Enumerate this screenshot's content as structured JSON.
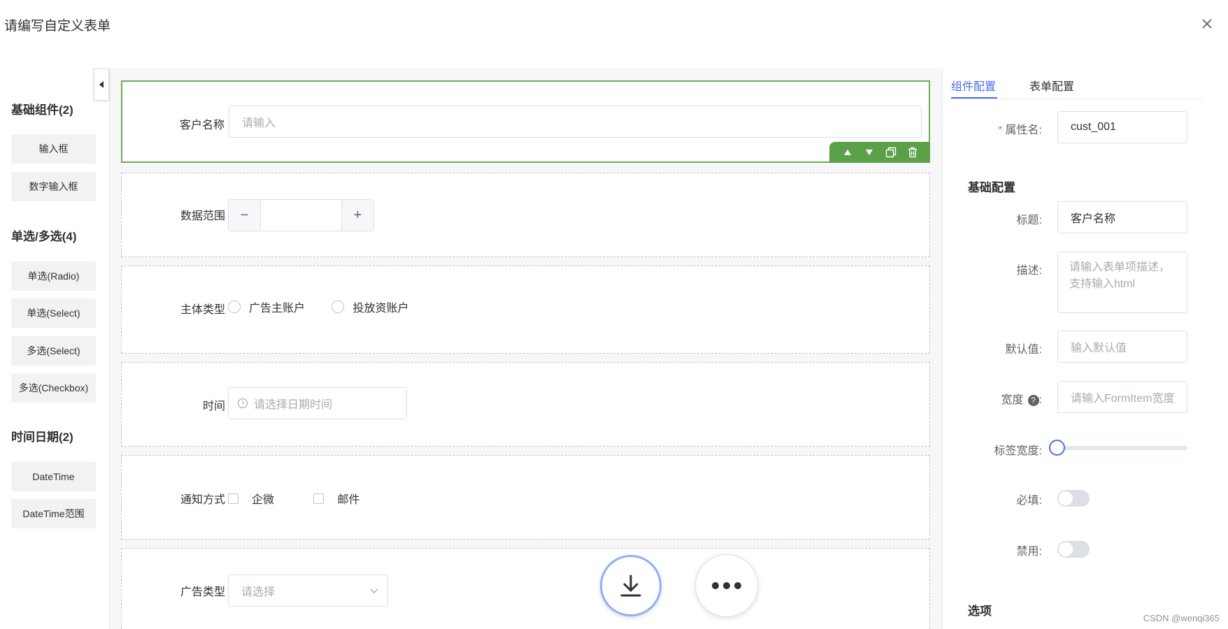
{
  "dialog": {
    "title": "请编写自定义表单"
  },
  "palette": {
    "groups": [
      {
        "title": "基础组件(2)",
        "items": [
          "输入框",
          "数字输入框"
        ]
      },
      {
        "title": "单选/多选(4)",
        "items": [
          "单选(Radio)",
          "单选(Select)",
          "多选(Select)",
          "多选(Checkbox)"
        ]
      },
      {
        "title": "时间日期(2)",
        "items": [
          "DateTime",
          "DateTime范围"
        ]
      }
    ]
  },
  "canvas": {
    "fields": [
      {
        "label": "客户名称",
        "type": "input",
        "placeholder": "请输入"
      },
      {
        "label": "数据范围",
        "type": "number",
        "minus": "−",
        "plus": "+"
      },
      {
        "label": "主体类型",
        "type": "radio",
        "options": [
          "广告主账户",
          "投放资账户"
        ]
      },
      {
        "label": "时间",
        "type": "datetime",
        "placeholder": "请选择日期时间"
      },
      {
        "label": "通知方式",
        "type": "checkbox",
        "options": [
          "企微",
          "邮件"
        ]
      },
      {
        "label": "广告类型",
        "type": "select",
        "placeholder": "请选择"
      }
    ]
  },
  "panel": {
    "tabs": [
      "组件配置",
      "表单配置"
    ],
    "active_tab": "组件配置",
    "property_name": {
      "label": "属性名",
      "value": "cust_001"
    },
    "basic_section": "基础配置",
    "title": {
      "label": "标题",
      "value": "客户名称"
    },
    "description": {
      "label": "描述",
      "placeholder": "请输入表单项描述，支持输入html"
    },
    "default_value": {
      "label": "默认值",
      "placeholder": "输入默认值"
    },
    "width": {
      "label": "宽度",
      "help": "?",
      "placeholder": "请输入FormItem宽度"
    },
    "label_width": {
      "label": "标签宽度",
      "value": 0
    },
    "required": {
      "label": "必填",
      "on": false
    },
    "disabled": {
      "label": "禁用",
      "on": false
    },
    "options_section": "选项",
    "colon": ":"
  },
  "colors": {
    "accent": "#4a6df0",
    "selected_border": "#6aad55",
    "toolbar": "#5aa14a"
  },
  "credit": "CSDN @wenqi365"
}
